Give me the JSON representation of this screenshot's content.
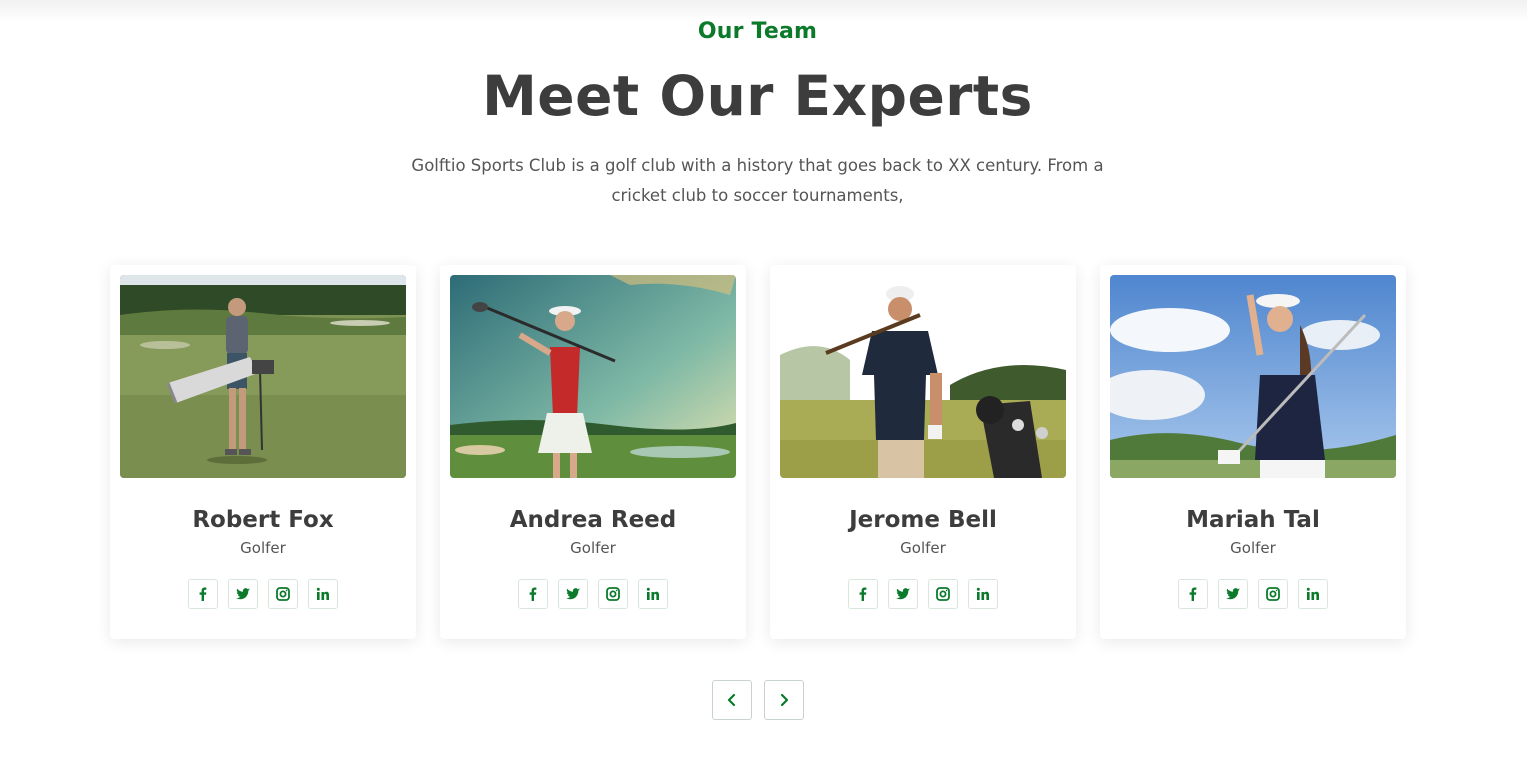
{
  "section": {
    "eyebrow": "Our Team",
    "heading": "Meet Our Experts",
    "intro": "Golftio Sports Club is a golf club with a history that goes back to XX century. From a cricket club to soccer tournaments,"
  },
  "colors": {
    "accent": "#0c7a2b",
    "heading": "#3d3d3d",
    "body_text": "#555555",
    "card_bg": "#ffffff"
  },
  "team": [
    {
      "name": "Robert Fox",
      "role": "Golfer",
      "photo": "man-with-golf-bag-on-course-photo",
      "socials": [
        "facebook-icon",
        "twitter-icon",
        "instagram-icon",
        "linkedin-icon"
      ]
    },
    {
      "name": "Andrea Reed",
      "role": "Golfer",
      "photo": "woman-in-red-shirt-with-club-photo",
      "socials": [
        "facebook-icon",
        "twitter-icon",
        "instagram-icon",
        "linkedin-icon"
      ]
    },
    {
      "name": "Jerome Bell",
      "role": "Golfer",
      "photo": "man-in-navy-shirt-with-club-photo",
      "socials": [
        "facebook-icon",
        "twitter-icon",
        "instagram-icon",
        "linkedin-icon"
      ]
    },
    {
      "name": "Mariah Tal",
      "role": "Golfer",
      "photo": "woman-in-navy-shirt-with-visor-photo",
      "socials": [
        "facebook-icon",
        "twitter-icon",
        "instagram-icon",
        "linkedin-icon"
      ]
    }
  ],
  "pager": {
    "prev_icon": "chevron-left-icon",
    "next_icon": "chevron-right-icon"
  }
}
